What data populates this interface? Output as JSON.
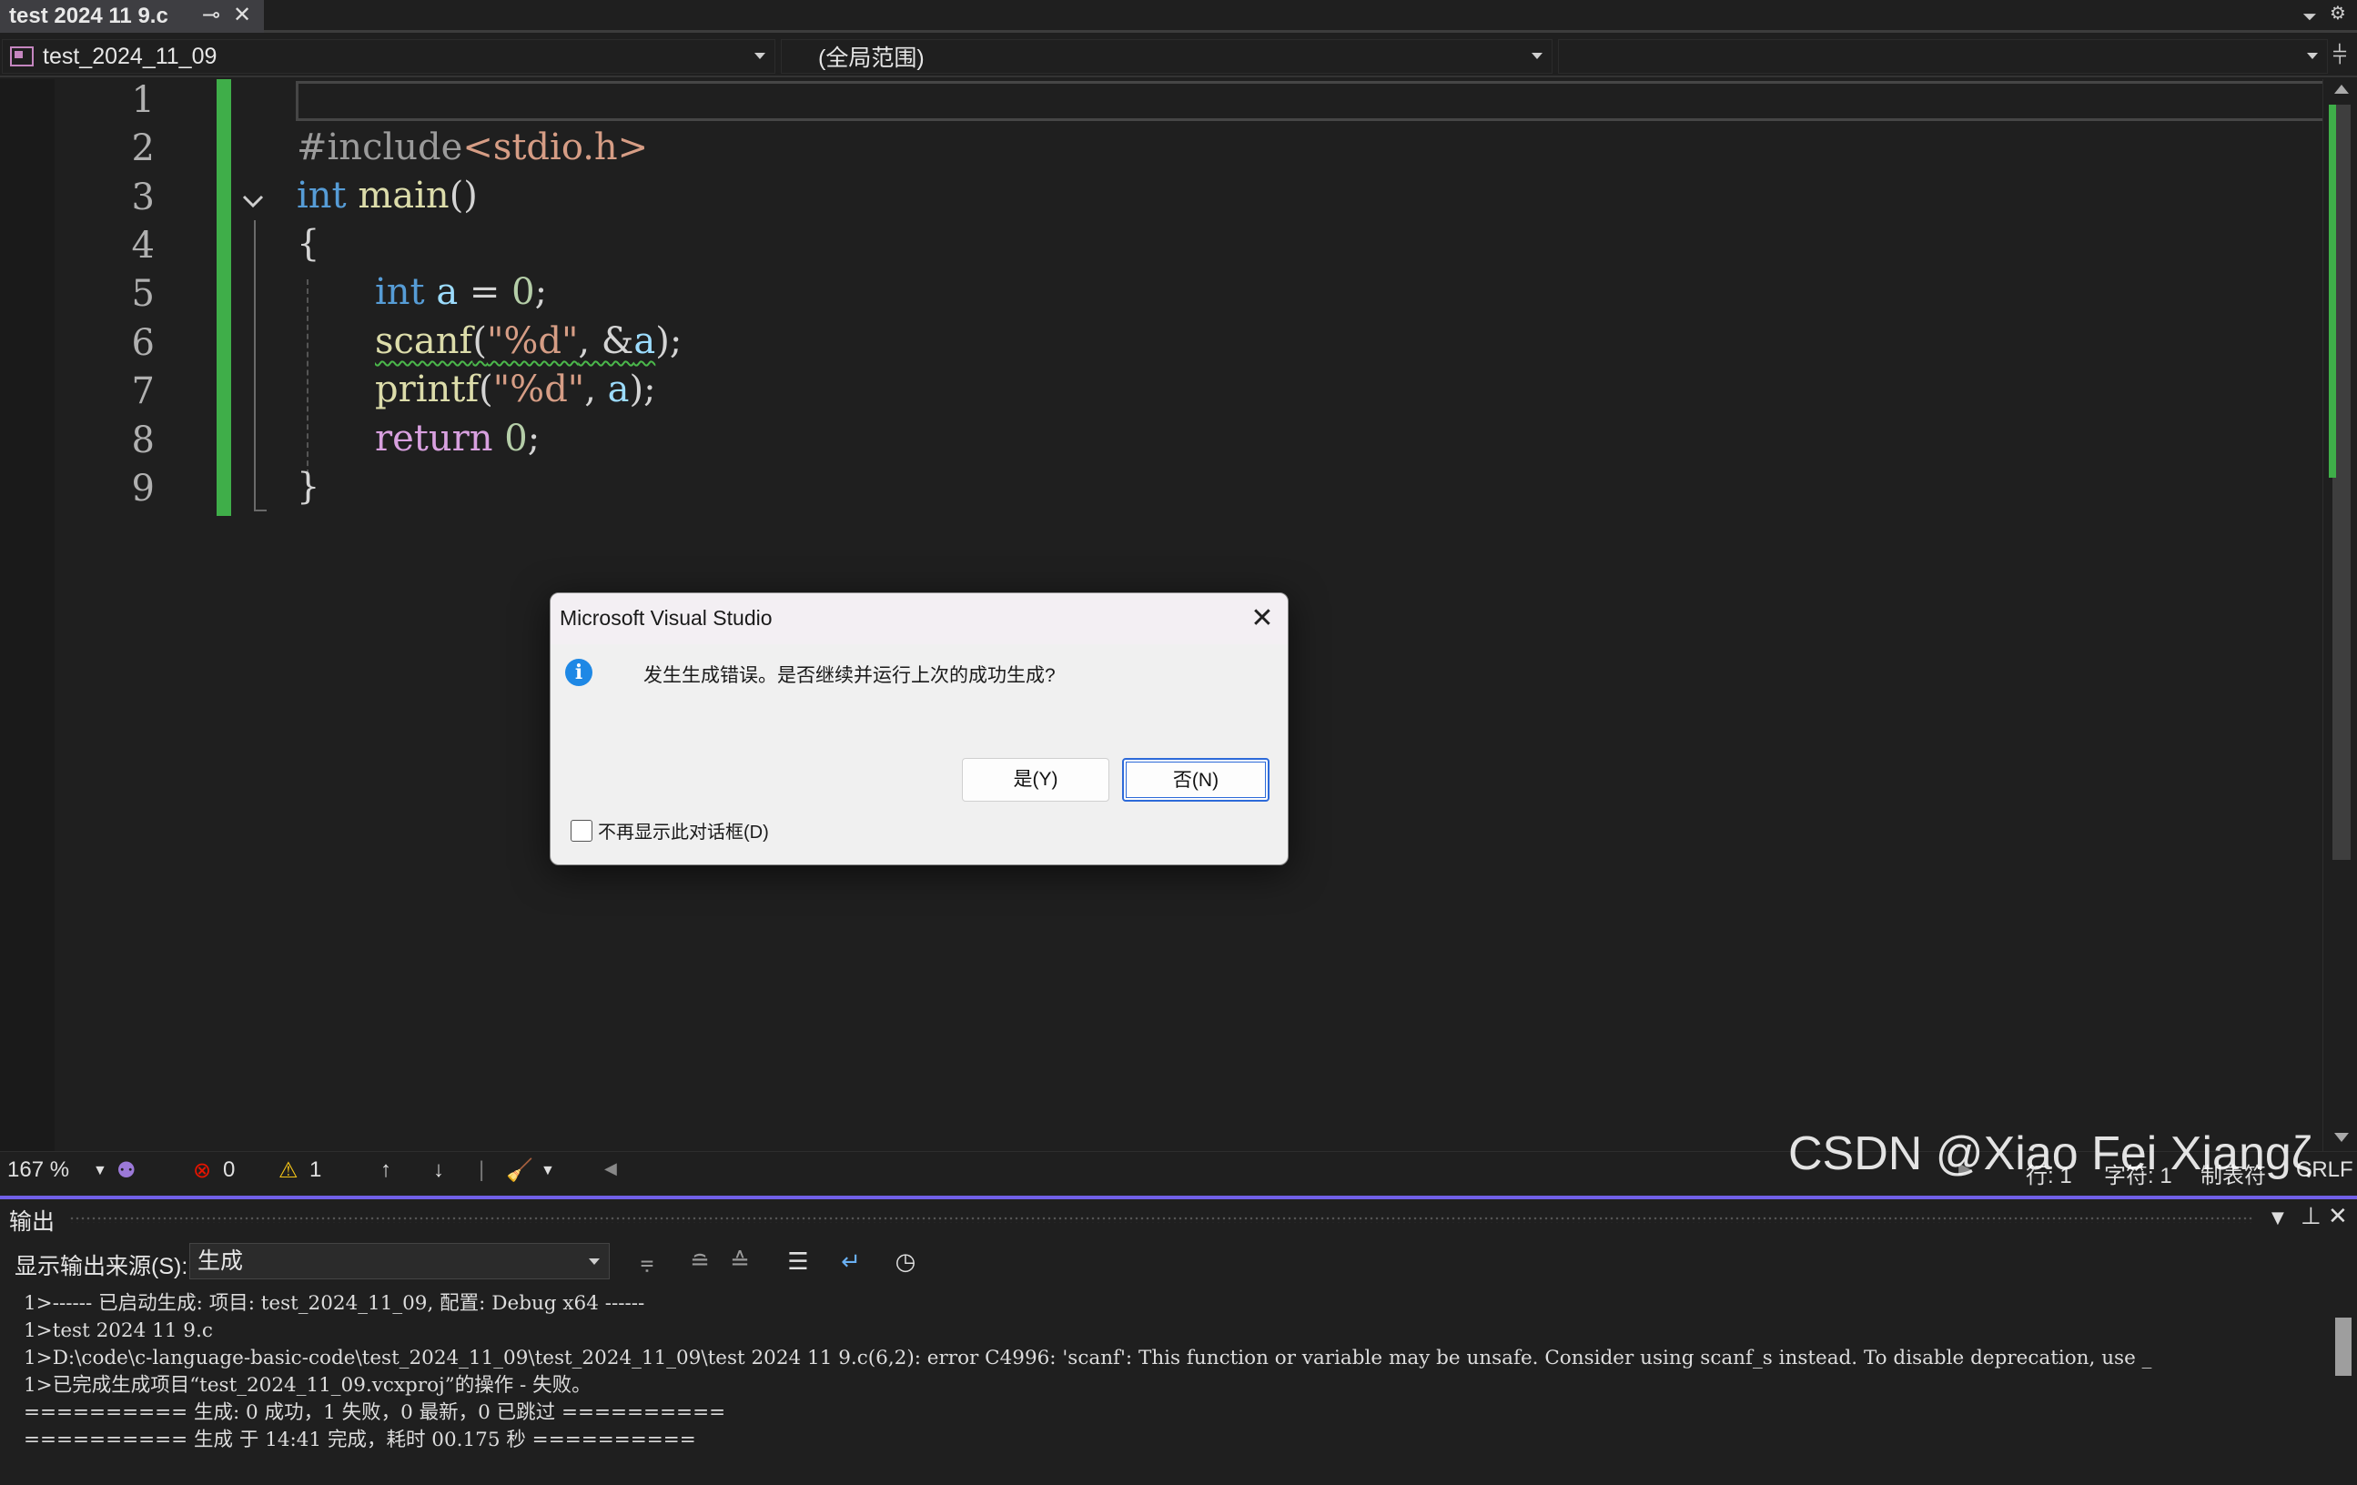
{
  "tab": {
    "title": "test 2024 11 9.c",
    "pin_icon": "⊸",
    "close_icon": "✕"
  },
  "navbar": {
    "project": "test_2024_11_09",
    "scope": "(全局范围)",
    "member": ""
  },
  "editor": {
    "line_numbers": [
      "1",
      "2",
      "3",
      "4",
      "5",
      "6",
      "7",
      "8",
      "9"
    ],
    "code": {
      "l2": "#include<stdio.h>",
      "l2_pp": "#include",
      "l2_hdr": "<stdio.h>",
      "l3_kw": "int",
      "l3_fn": " main",
      "l3_rest": "()",
      "l4": "{",
      "l5_kw": "int",
      "l5_var": " a",
      "l5_rest": " = ",
      "l5_num": "0",
      "l5_end": ";",
      "l6_fn": "scanf",
      "l6_open": "(",
      "l6_str": "\"%d\"",
      "l6_mid": ", &",
      "l6_var": "a",
      "l6_end": ");",
      "l7_fn": "printf",
      "l7_open": "(",
      "l7_str": "\"%d\"",
      "l7_mid": ", ",
      "l7_var": "a",
      "l7_end": ");",
      "l8_kw": "return",
      "l8_sp": " ",
      "l8_num": "0",
      "l8_end": ";",
      "l9": "}"
    }
  },
  "status": {
    "zoom": "167 %",
    "errors": "0",
    "warnings": "1",
    "line": "行: 1",
    "char": "字符: 1",
    "tabs": "制表符",
    "eol": "CRLF"
  },
  "output": {
    "title": "输出",
    "source_label": "显示输出来源(S):",
    "source_value": "生成",
    "lines": [
      "1>------ 已启动生成: 项目: test_2024_11_09, 配置: Debug x64 ------",
      "1>test 2024 11 9.c",
      "1>D:\\code\\c-language-basic-code\\test_2024_11_09\\test_2024_11_09\\test 2024 11 9.c(6,2): error C4996: 'scanf': This function or variable may be unsafe. Consider using scanf_s instead. To disable deprecation, use _",
      "1>已完成生成项目“test_2024_11_09.vcxproj”的操作 - 失败。",
      "========== 生成: 0 成功，1 失败，0 最新，0 已跳过 ==========",
      "========== 生成 于 14:41 完成，耗时 00.175 秒 =========="
    ]
  },
  "watermark": "CSDN @Xiao Fei Xiangζ",
  "dialog": {
    "title": "Microsoft Visual Studio",
    "message": "发生生成错误。是否继续并运行上次的成功生成?",
    "yes_label": "是(Y)",
    "no_label": "否(N)",
    "dont_show_label": "不再显示此对话框(D)"
  },
  "colors": {
    "accent": "#7160e8",
    "change_bar": "#3fae49",
    "info": "#1e88e5",
    "error": "#e51400",
    "warning": "#f5c518"
  }
}
